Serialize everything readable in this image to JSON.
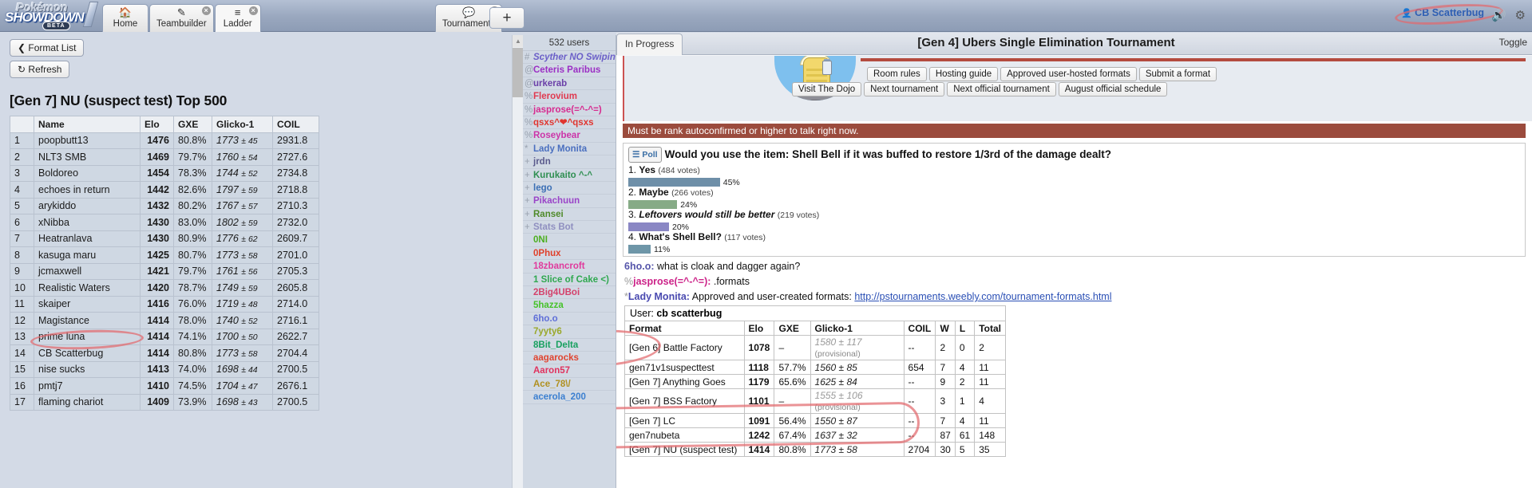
{
  "app": {
    "logo_top": "Pokémon",
    "logo_main": "SHOWDOWN",
    "logo_beta": "BETA",
    "username": "CB Scatterbug"
  },
  "tabs": [
    {
      "label": "Home",
      "icon": "home-icon",
      "closable": false,
      "active": false
    },
    {
      "label": "Teambuilder",
      "icon": "pencil-icon",
      "closable": true,
      "active": false
    },
    {
      "label": "Ladder",
      "icon": "list-icon",
      "closable": true,
      "active": true
    },
    {
      "label": "Tournaments",
      "icon": "chat-icon",
      "closable": true,
      "active": false
    }
  ],
  "add_tab_label": "+",
  "ladder": {
    "format_list_button": "Format List",
    "refresh_button": "Refresh",
    "title": "[Gen 7] NU (suspect test) Top 500",
    "columns": [
      "",
      "Name",
      "Elo",
      "GXE",
      "Glicko-1",
      "COIL"
    ],
    "rows": [
      {
        "rank": "1",
        "name": "poopbutt13",
        "elo": "1476",
        "gxe": "80.8%",
        "glicko": "1773",
        "dev": "45",
        "coil": "2931.8"
      },
      {
        "rank": "2",
        "name": "NLT3 SMB",
        "elo": "1469",
        "gxe": "79.7%",
        "glicko": "1760",
        "dev": "54",
        "coil": "2727.6"
      },
      {
        "rank": "3",
        "name": "Boldoreo",
        "elo": "1454",
        "gxe": "78.3%",
        "glicko": "1744",
        "dev": "52",
        "coil": "2734.8"
      },
      {
        "rank": "4",
        "name": "echoes in return",
        "elo": "1442",
        "gxe": "82.6%",
        "glicko": "1797",
        "dev": "59",
        "coil": "2718.8"
      },
      {
        "rank": "5",
        "name": "arykiddo",
        "elo": "1432",
        "gxe": "80.2%",
        "glicko": "1767",
        "dev": "57",
        "coil": "2710.3"
      },
      {
        "rank": "6",
        "name": "xNibba",
        "elo": "1430",
        "gxe": "83.0%",
        "glicko": "1802",
        "dev": "59",
        "coil": "2732.0"
      },
      {
        "rank": "7",
        "name": "Heatranlava",
        "elo": "1430",
        "gxe": "80.9%",
        "glicko": "1776",
        "dev": "62",
        "coil": "2609.7"
      },
      {
        "rank": "8",
        "name": "kasuga maru",
        "elo": "1425",
        "gxe": "80.7%",
        "glicko": "1773",
        "dev": "58",
        "coil": "2701.0"
      },
      {
        "rank": "9",
        "name": "jcmaxwell",
        "elo": "1421",
        "gxe": "79.7%",
        "glicko": "1761",
        "dev": "56",
        "coil": "2705.3"
      },
      {
        "rank": "10",
        "name": "Realistic Waters",
        "elo": "1420",
        "gxe": "78.7%",
        "glicko": "1749",
        "dev": "59",
        "coil": "2605.8"
      },
      {
        "rank": "11",
        "name": "skaiper",
        "elo": "1416",
        "gxe": "76.0%",
        "glicko": "1719",
        "dev": "48",
        "coil": "2714.0"
      },
      {
        "rank": "12",
        "name": "Magistance",
        "elo": "1414",
        "gxe": "78.0%",
        "glicko": "1740",
        "dev": "52",
        "coil": "2716.1"
      },
      {
        "rank": "13",
        "name": "prime luna",
        "elo": "1414",
        "gxe": "74.1%",
        "glicko": "1700",
        "dev": "50",
        "coil": "2622.7"
      },
      {
        "rank": "14",
        "name": "CB Scatterbug",
        "elo": "1414",
        "gxe": "80.8%",
        "glicko": "1773",
        "dev": "58",
        "coil": "2704.4"
      },
      {
        "rank": "15",
        "name": "nise sucks",
        "elo": "1413",
        "gxe": "74.0%",
        "glicko": "1698",
        "dev": "44",
        "coil": "2700.5"
      },
      {
        "rank": "16",
        "name": "pmtj7",
        "elo": "1410",
        "gxe": "74.5%",
        "glicko": "1704",
        "dev": "47",
        "coil": "2676.1"
      },
      {
        "rank": "17",
        "name": "flaming chariot",
        "elo": "1409",
        "gxe": "73.9%",
        "glicko": "1698",
        "dev": "43",
        "coil": "2700.5"
      }
    ]
  },
  "userlist": {
    "count_label": "532 users",
    "users": [
      {
        "sym": "#",
        "name": "Scyther NO Swiping",
        "color": "#6b5fc8",
        "italic": true
      },
      {
        "sym": "@",
        "name": "Ceteris Paribus",
        "color": "#9b2fc4",
        "italic": false
      },
      {
        "sym": "@",
        "name": "urkerab",
        "color": "#6b40a8",
        "italic": false
      },
      {
        "sym": "%",
        "name": "Flerovium",
        "color": "#e03a50",
        "italic": false
      },
      {
        "sym": "%",
        "name": "jasprose(=^-^=)",
        "color": "#d62a8f",
        "italic": false
      },
      {
        "sym": "%",
        "name": "qsxs^❤^qsxs",
        "color": "#e0352f",
        "italic": false
      },
      {
        "sym": "%",
        "name": "Roseybear",
        "color": "#cc33a8",
        "italic": false
      },
      {
        "sym": "*",
        "name": "Lady Monita",
        "color": "#4a6fbf",
        "italic": false
      },
      {
        "sym": "+",
        "name": "jrdn",
        "color": "#5a5a8c",
        "italic": false
      },
      {
        "sym": "+",
        "name": "Kurukaito ^-^",
        "color": "#2f8f52",
        "italic": false
      },
      {
        "sym": "+",
        "name": "lego",
        "color": "#3b6fb5",
        "italic": false
      },
      {
        "sym": "+",
        "name": "Pikachuun",
        "color": "#9a45c8",
        "italic": false
      },
      {
        "sym": "+",
        "name": "Ransei",
        "color": "#4f8a2a",
        "italic": false
      },
      {
        "sym": "+",
        "name": "Stats Bot",
        "color": "#8f8fc0",
        "italic": false
      },
      {
        "sym": " ",
        "name": "0NI",
        "color": "#4caf1f",
        "italic": false
      },
      {
        "sym": " ",
        "name": "0Phux",
        "color": "#e0402a",
        "italic": false
      },
      {
        "sym": " ",
        "name": "18zbancroft",
        "color": "#e03a9c",
        "italic": false
      },
      {
        "sym": " ",
        "name": "1 Slice of Cake <)",
        "color": "#2fa84f",
        "italic": false
      },
      {
        "sym": " ",
        "name": "2Big4UBoi",
        "color": "#d4416b",
        "italic": false
      },
      {
        "sym": " ",
        "name": "5hazza",
        "color": "#46c22a",
        "italic": false
      },
      {
        "sym": " ",
        "name": "6ho.o",
        "color": "#5f6fd8",
        "italic": false
      },
      {
        "sym": " ",
        "name": "7yyty6",
        "color": "#9aa82a",
        "italic": false
      },
      {
        "sym": " ",
        "name": "8Bit_Delta",
        "color": "#17a05f",
        "italic": false
      },
      {
        "sym": " ",
        "name": "aagarocks",
        "color": "#e0442f",
        "italic": false
      },
      {
        "sym": " ",
        "name": "Aaron57",
        "color": "#e0325e",
        "italic": false
      },
      {
        "sym": " ",
        "name": "Ace_78\\/",
        "color": "#b09020",
        "italic": false
      },
      {
        "sym": " ",
        "name": "acerola_200",
        "color": "#3b7fd0",
        "italic": false
      }
    ]
  },
  "chat": {
    "in_progress_tab": "In Progress",
    "tournament_title": "[Gen 4] Ubers Single Elimination Tournament",
    "toggle_button": "Toggle",
    "room_buttons_row1": [
      "Room rules",
      "Hosting guide",
      "Approved user-hosted formats",
      "Submit a format"
    ],
    "room_buttons_row2": [
      "Visit The Dojo",
      "Next tournament",
      "Next official tournament",
      "August official schedule"
    ],
    "warning": "Must be rank autoconfirmed or higher to talk right now.",
    "poll": {
      "badge": "Poll",
      "question": "Would you use the item: Shell Bell if it was buffed to restore 1/3rd of the damage dealt?",
      "options": [
        {
          "num": "1.",
          "label": "Yes",
          "votes": "(484 votes)",
          "pct": "45%",
          "pct_val": 45,
          "color": "#6e8fa8",
          "italic": false
        },
        {
          "num": "2.",
          "label": "Maybe",
          "votes": "(266 votes)",
          "pct": "24%",
          "pct_val": 24,
          "color": "#86ab86",
          "italic": false
        },
        {
          "num": "3.",
          "label": "Leftovers would still be better",
          "votes": "(219 votes)",
          "pct": "20%",
          "pct_val": 20,
          "color": "#8a87c4",
          "italic": true
        },
        {
          "num": "4.",
          "label": "What's Shell Bell?",
          "votes": "(117 votes)",
          "pct": "11%",
          "pct_val": 11,
          "color": "#6e96a8",
          "italic": false
        }
      ]
    },
    "messages": [
      {
        "rank": "",
        "user": "6ho.o:",
        "user_class": "uname-6ho",
        "text": "what is cloak and dagger again?",
        "link": ""
      },
      {
        "rank": "%",
        "user": "jasprose(=^-^=):",
        "user_class": "uname-jas",
        "text": ".formats",
        "link": ""
      },
      {
        "rank": "*",
        "user": "Lady Monita:",
        "user_class": "uname-lady",
        "text": "Approved and user-created formats:",
        "link": "http://pstournaments.weebly.com/tournament-formats.html"
      }
    ],
    "stats": {
      "user_label": "User:",
      "user_name": "cb scatterbug",
      "columns": [
        "Format",
        "Elo",
        "GXE",
        "Glicko-1",
        "COIL",
        "W",
        "L",
        "Total"
      ],
      "rows": [
        {
          "format": "[Gen 6] Battle Factory",
          "elo": "1078",
          "gxe": "–",
          "glicko": "1580 ± 117",
          "prov": "(provisional)",
          "provisional": true,
          "coil": "--",
          "w": "2",
          "l": "0",
          "total": "2"
        },
        {
          "format": "gen71v1suspecttest",
          "elo": "1118",
          "gxe": "57.7%",
          "glicko": "1560 ± 85",
          "prov": "",
          "provisional": false,
          "coil": "654",
          "w": "7",
          "l": "4",
          "total": "11"
        },
        {
          "format": "[Gen 7] Anything Goes",
          "elo": "1179",
          "gxe": "65.6%",
          "glicko": "1625 ± 84",
          "prov": "",
          "provisional": false,
          "coil": "--",
          "w": "9",
          "l": "2",
          "total": "11"
        },
        {
          "format": "[Gen 7] BSS Factory",
          "elo": "1101",
          "gxe": "–",
          "glicko": "1555 ± 106",
          "prov": "(provisional)",
          "provisional": true,
          "coil": "--",
          "w": "3",
          "l": "1",
          "total": "4"
        },
        {
          "format": "[Gen 7] LC",
          "elo": "1091",
          "gxe": "56.4%",
          "glicko": "1550 ± 87",
          "prov": "",
          "provisional": false,
          "coil": "--",
          "w": "7",
          "l": "4",
          "total": "11"
        },
        {
          "format": "gen7nubeta",
          "elo": "1242",
          "gxe": "67.4%",
          "glicko": "1637 ± 32",
          "prov": "",
          "provisional": false,
          "coil": "--",
          "w": "87",
          "l": "61",
          "total": "148"
        },
        {
          "format": "[Gen 7] NU (suspect test)",
          "elo": "1414",
          "gxe": "80.8%",
          "glicko": "1773 ± 58",
          "prov": "",
          "provisional": false,
          "coil": "2704",
          "w": "30",
          "l": "5",
          "total": "35"
        }
      ]
    }
  }
}
